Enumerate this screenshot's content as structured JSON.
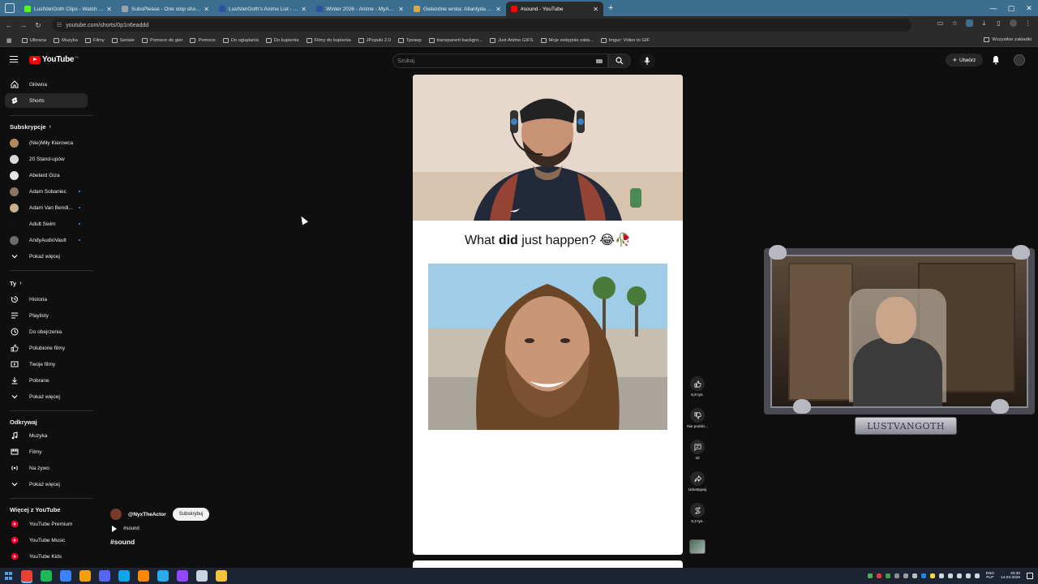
{
  "browser": {
    "tabs": [
      {
        "label": "LustVanGoth Clips - Watch Live",
        "favicon_color": "#53fc18",
        "active": false
      },
      {
        "label": "SubsPlease - One stop shop fo",
        "favicon_color": "#9aa3ad",
        "active": false
      },
      {
        "label": "LustVanGoth's Anime List - My",
        "favicon_color": "#2e51a2",
        "active": false
      },
      {
        "label": "Winter 2026 - Anime - MyAnim",
        "favicon_color": "#2e51a2",
        "active": false
      },
      {
        "label": "Gwiezdne wrota: Atlantyda / St",
        "favicon_color": "#d7a94b",
        "active": false
      },
      {
        "label": "#sound - YouTube",
        "favicon_color": "#ff0000",
        "active": true
      }
    ],
    "url": "youtube.com/shorts/0p1n6eaddd",
    "bookmarks": [
      "Ulbrana",
      "Muzyka",
      "Filmy",
      "Seriale",
      "Pomoce do gier",
      "Pomoce",
      "Do oglądania",
      "Do kupienia",
      "Filmy do kupienia",
      "JPopuki 2.0",
      "Трекер",
      "transparent backgro...",
      "Just Anime GIFS",
      "Moje wstępnie zatw...",
      "Imgur: Video to GIF"
    ],
    "bookmarks_right": "Wszystkie zakładki"
  },
  "header": {
    "logo_text": "YouTube",
    "country_code": "PL",
    "search_placeholder": "Szukaj",
    "create_label": "Utwórz"
  },
  "sidebar": {
    "main": [
      {
        "label": "Główna",
        "icon": "home-icon"
      },
      {
        "label": "Shorts",
        "icon": "shorts-icon",
        "active": true
      }
    ],
    "subscriptions_title": "Subskrypcje",
    "subscriptions": [
      {
        "label": "(Nie)Miły Kierowca",
        "avatar_color": "#b08a5a",
        "live_dot": false
      },
      {
        "label": "20 Stand-upów",
        "avatar_color": "#d9d9d9",
        "live_dot": false
      },
      {
        "label": "Abelard Giza",
        "avatar_color": "#e6e6e6",
        "live_dot": false
      },
      {
        "label": "Adam Sobaniec",
        "avatar_color": "#8a7565",
        "live_dot": true
      },
      {
        "label": "Adam Van Bendl...",
        "avatar_color": "#c9b08a",
        "live_dot": true
      },
      {
        "label": "Adult Swim",
        "avatar_color": "#111111",
        "live_dot": true
      },
      {
        "label": "AndyAudioVault",
        "avatar_color": "#6b6b6b",
        "live_dot": true
      }
    ],
    "show_more": "Pokaż więcej",
    "you_title": "Ty",
    "you_items": [
      {
        "label": "Historia",
        "icon": "history-icon"
      },
      {
        "label": "Playlisty",
        "icon": "playlist-icon"
      },
      {
        "label": "Do obejrzenia",
        "icon": "watch-later-icon"
      },
      {
        "label": "Polubione filmy",
        "icon": "like-icon"
      },
      {
        "label": "Twoje filmy",
        "icon": "your-videos-icon"
      },
      {
        "label": "Pobrane",
        "icon": "download-icon"
      }
    ],
    "explore_title": "Odkrywaj",
    "explore_items": [
      {
        "label": "Muzyka",
        "icon": "music-icon"
      },
      {
        "label": "Filmy",
        "icon": "film-icon"
      },
      {
        "label": "Na żywo",
        "icon": "live-icon"
      }
    ],
    "more_title": "Więcej z YouTube",
    "more_items": [
      {
        "label": "YouTube Premium",
        "color": "#ff0033"
      },
      {
        "label": "YouTube Music",
        "color": "#ff0033"
      },
      {
        "label": "YouTube Kids",
        "color": "#ff0033"
      }
    ]
  },
  "short": {
    "caption_pre": "What ",
    "caption_bold": "did",
    "caption_post": " just happen? 😂🥀",
    "channel": "@NyxTheActor",
    "subscribe_label": "Subskrybuj",
    "sound_label": "#sound",
    "hashtag": "#sound"
  },
  "actions": {
    "likes": "6,8 tys.",
    "dislike_label": "Nie podob...",
    "comments": "42",
    "share_label": "Udostępnij",
    "remixes": "9,2 tys."
  },
  "webcam": {
    "label": "LUSTVANGOTH"
  },
  "taskbar": {
    "apps": [
      {
        "name": "chrome",
        "color": "#e94235"
      },
      {
        "name": "spotify",
        "color": "#1db954"
      },
      {
        "name": "app-blue",
        "color": "#3b82f6"
      },
      {
        "name": "app-orange",
        "color": "#f59e0b"
      },
      {
        "name": "discord",
        "color": "#5865f2"
      },
      {
        "name": "app-cyan",
        "color": "#0ea5e9"
      },
      {
        "name": "vlc",
        "color": "#ff8800"
      },
      {
        "name": "telegram",
        "color": "#2aabee"
      },
      {
        "name": "twitch",
        "color": "#9146ff"
      },
      {
        "name": "steam",
        "color": "#c7d5e0"
      },
      {
        "name": "explorer",
        "color": "#f3c43b"
      }
    ],
    "lang_top": "ENG",
    "lang_bottom": "PLP",
    "time": "20:30",
    "date": "14.03.2026"
  }
}
